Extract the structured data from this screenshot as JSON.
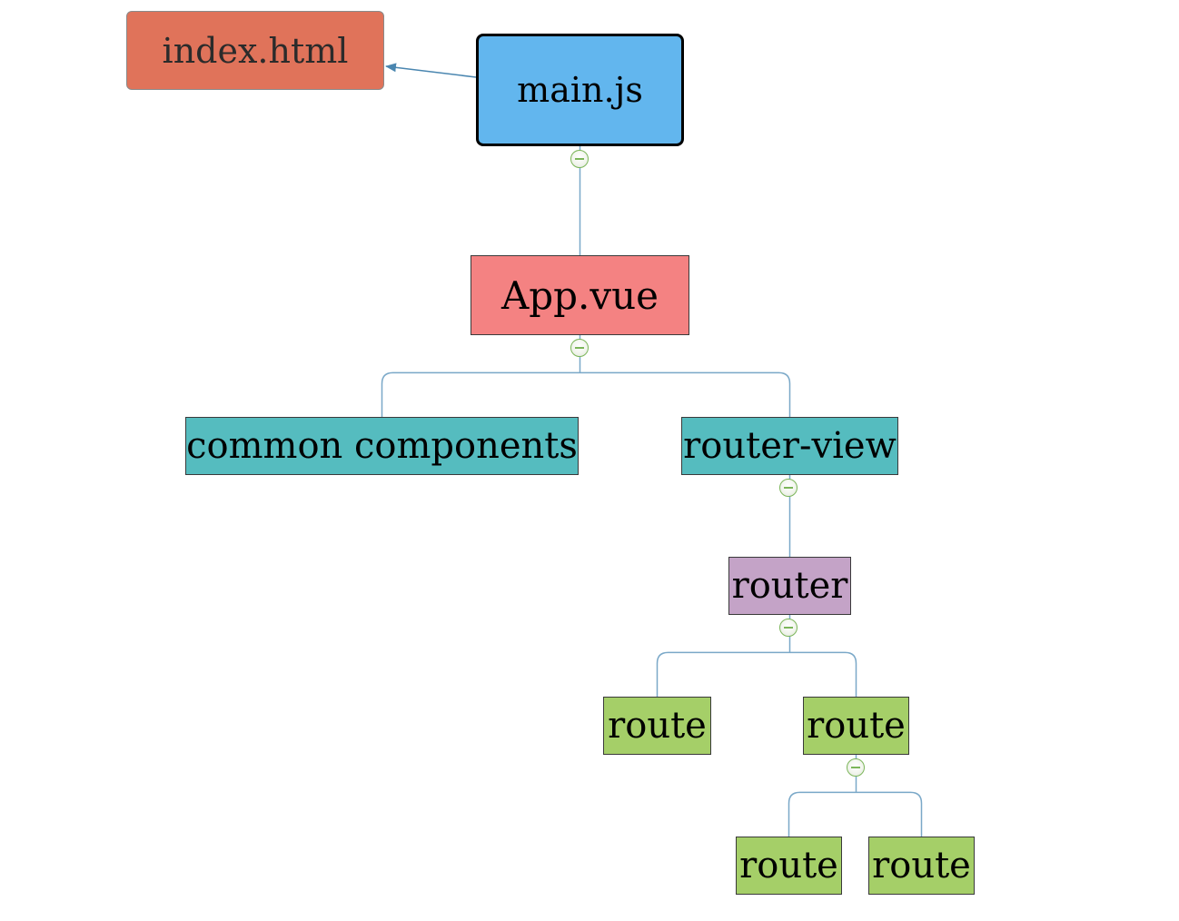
{
  "diagram": {
    "type": "mind-map / tree",
    "nodes": [
      {
        "id": "index",
        "label": "index.html",
        "color": "#e0735a"
      },
      {
        "id": "main",
        "label": "main.js",
        "color": "#62b6ee"
      },
      {
        "id": "app",
        "label": "App.vue",
        "color": "#f48282"
      },
      {
        "id": "common",
        "label": "common components",
        "color": "#55bcbf"
      },
      {
        "id": "routerview",
        "label": "router-view",
        "color": "#55bcbf"
      },
      {
        "id": "router",
        "label": "router",
        "color": "#c4a3c7"
      },
      {
        "id": "route1",
        "label": "route",
        "color": "#a5cf68"
      },
      {
        "id": "route2",
        "label": "route",
        "color": "#a5cf68"
      },
      {
        "id": "route3",
        "label": "route",
        "color": "#a5cf68"
      },
      {
        "id": "route4",
        "label": "route",
        "color": "#a5cf68"
      }
    ],
    "edges": [
      {
        "from": "main",
        "to": "index",
        "kind": "arrow"
      },
      {
        "from": "main",
        "to": "app",
        "kind": "tree"
      },
      {
        "from": "app",
        "to": "common",
        "kind": "tree"
      },
      {
        "from": "app",
        "to": "routerview",
        "kind": "tree"
      },
      {
        "from": "routerview",
        "to": "router",
        "kind": "tree"
      },
      {
        "from": "router",
        "to": "route1",
        "kind": "tree"
      },
      {
        "from": "router",
        "to": "route2",
        "kind": "tree"
      },
      {
        "from": "route2",
        "to": "route3",
        "kind": "tree"
      },
      {
        "from": "route2",
        "to": "route4",
        "kind": "tree"
      }
    ],
    "link_color": "#7aa8c8",
    "arrow_color": "#4a86b0"
  }
}
